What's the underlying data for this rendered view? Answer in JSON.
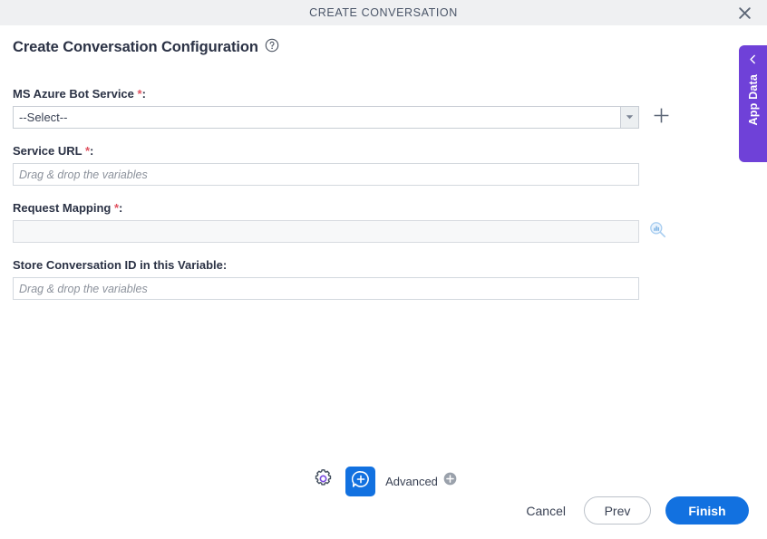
{
  "window": {
    "title": "CREATE CONVERSATION",
    "close_icon": "close-icon"
  },
  "page": {
    "heading": "Create Conversation Configuration",
    "help_icon": "help-circle-icon"
  },
  "form": {
    "fields": [
      {
        "label": "MS Azure Bot Service",
        "required_mark": "*",
        "colon": ":",
        "type": "select",
        "value": "--Select--",
        "dropdown_icon": "chevron-down-icon",
        "action_icon": "plus-icon"
      },
      {
        "label": "Service URL",
        "required_mark": "*",
        "colon": ":",
        "type": "text",
        "value": "",
        "placeholder": "Drag & drop the variables"
      },
      {
        "label": "Request Mapping",
        "required_mark": "*",
        "colon": ":",
        "type": "text-filled",
        "value": "",
        "placeholder": "",
        "action_icon": "search-data-icon"
      },
      {
        "label": "Store Conversation ID in this Variable",
        "required_mark": "",
        "colon": ":",
        "type": "text",
        "value": "",
        "placeholder": "Drag & drop the variables"
      }
    ]
  },
  "side_tab": {
    "label": "App Data",
    "collapse_icon": "chevron-left-icon"
  },
  "toolbar": {
    "settings_icon": "gear-icon",
    "add_conversation_icon": "chat-bubble-plus-icon",
    "advanced_label": "Advanced",
    "advanced_icon": "circle-plus-icon"
  },
  "footer": {
    "cancel_label": "Cancel",
    "prev_label": "Prev",
    "finish_label": "Finish"
  },
  "colors": {
    "accent_blue": "#1271e0",
    "purple": "#6f41d8",
    "required_red": "#e05260",
    "header_bg": "#eff0f2",
    "text_dark": "#2b3245"
  }
}
